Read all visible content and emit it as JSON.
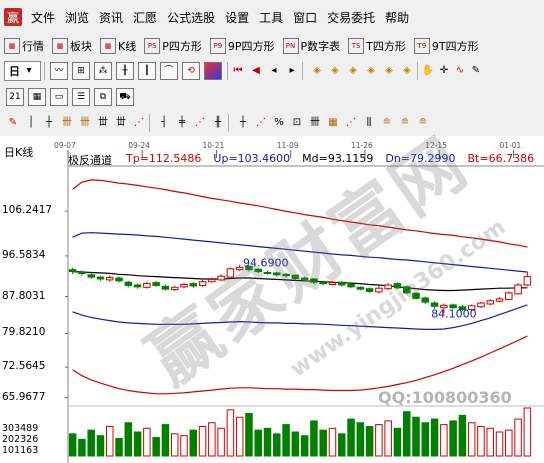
{
  "app": {
    "logo": "赢"
  },
  "menu": [
    "文件",
    "浏览",
    "资讯",
    "汇愿",
    "公式选股",
    "设置",
    "工具",
    "窗口",
    "交易委托",
    "帮助"
  ],
  "toolbar1": [
    {
      "label": "行情",
      "icon": "grid-icon"
    },
    {
      "label": "板块",
      "icon": "blocks-icon"
    },
    {
      "label": "K线",
      "icon": "candle-icon"
    },
    {
      "label": "P四方形",
      "icon": "p-icon",
      "badge": "PS"
    },
    {
      "label": "9P四方形",
      "icon": "p9-icon",
      "badge": "P9"
    },
    {
      "label": "P数字表",
      "icon": "pn-icon",
      "badge": "PN"
    },
    {
      "label": "T四方形",
      "icon": "t-icon",
      "badge": "TS"
    },
    {
      "label": "9T四方形",
      "icon": "t9-icon",
      "badge": "T9"
    }
  ],
  "toolbar2": {
    "period_select": "日"
  },
  "chart": {
    "period_label": "日K线",
    "indicator_name": "极反通道",
    "indicators": [
      {
        "label": "Tp=112.5486",
        "color": "#d40000"
      },
      {
        "label": "Up=103.4600",
        "color": "#1a1aa8"
      },
      {
        "label": "Md=93.1159",
        "color": "#000000"
      },
      {
        "label": "Dn=79.2990",
        "color": "#1a1aa8"
      },
      {
        "label": "Bt=66.7386",
        "color": "#d40000"
      }
    ],
    "y_ticks": [
      "106.2417",
      "96.5834",
      "87.8031",
      "79.8210",
      "72.5645",
      "65.9677"
    ],
    "volume_ticks": [
      "303489",
      "202326",
      "101163"
    ],
    "date_ticks": [
      "09-07",
      "09-24",
      "10-21",
      "11-09",
      "11-26",
      "12-15",
      "01-01"
    ],
    "annotations": [
      "94.6900",
      "84.1000"
    ],
    "watermark_text": "赢家财富网",
    "watermark_url": "www.yingjia360.com",
    "qq": "QQ:100800360"
  },
  "chart_data": {
    "type": "candlestick",
    "x": [
      "09-07",
      "09-24",
      "10-21",
      "11-09",
      "11-26",
      "12-15",
      "01-01"
    ],
    "ylim": [
      62,
      116
    ],
    "high_marker": 94.69,
    "low_marker": 84.1,
    "closes": [
      93.2,
      92.8,
      92.0,
      91.6,
      91.9,
      91.2,
      90.2,
      89.9,
      90.6,
      90.2,
      89.4,
      89.8,
      90.4,
      90.1,
      91.0,
      91.5,
      92.2,
      93.8,
      94.1,
      93.6,
      93.2,
      92.8,
      92.5,
      92.3,
      91.7,
      91.5,
      90.9,
      90.6,
      90.8,
      90.3,
      89.9,
      89.4,
      88.9,
      89.6,
      90.3,
      89.7,
      88.6,
      87.4,
      86.6,
      85.7,
      85.9,
      85.4,
      85.0,
      85.8,
      86.4,
      86.9,
      87.3,
      88.6,
      90.3,
      92.1
    ],
    "opens": [
      93.6,
      93.0,
      92.5,
      92.0,
      91.4,
      91.8,
      90.9,
      90.3,
      89.8,
      90.8,
      90.0,
      89.3,
      89.9,
      90.6,
      90.2,
      91.0,
      91.4,
      92.0,
      93.6,
      94.3,
      93.7,
      93.0,
      92.9,
      92.6,
      92.4,
      91.8,
      91.6,
      90.9,
      90.4,
      90.9,
      90.4,
      89.8,
      89.5,
      88.8,
      89.5,
      90.6,
      89.9,
      88.5,
      87.5,
      86.4,
      85.4,
      86.0,
      85.6,
      85.0,
      85.6,
      86.2,
      86.8,
      87.2,
      88.4,
      90.3
    ],
    "highs": [
      94.0,
      93.5,
      92.9,
      92.3,
      92.4,
      92.1,
      91.2,
      90.6,
      91.0,
      91.2,
      90.4,
      90.1,
      90.8,
      90.9,
      91.4,
      91.9,
      92.6,
      94.1,
      94.69,
      94.6,
      94.0,
      93.4,
      93.1,
      92.9,
      92.6,
      92.1,
      91.8,
      91.1,
      91.1,
      91.1,
      90.6,
      90.0,
      89.8,
      90.1,
      90.7,
      90.9,
      90.2,
      88.7,
      87.8,
      86.8,
      86.3,
      86.3,
      85.9,
      86.1,
      86.7,
      87.2,
      87.7,
      88.9,
      90.7,
      93.2
    ],
    "lows": [
      92.6,
      92.3,
      91.6,
      91.2,
      91.0,
      90.8,
      89.8,
      89.5,
      89.5,
      89.9,
      89.1,
      89.0,
      89.6,
      89.7,
      89.9,
      90.8,
      91.1,
      91.8,
      93.3,
      93.2,
      92.8,
      92.5,
      92.1,
      91.9,
      91.4,
      91.2,
      90.5,
      90.2,
      90.2,
      90.0,
      89.6,
      89.1,
      88.6,
      88.5,
      89.2,
      89.4,
      88.3,
      87.1,
      86.2,
      85.2,
      84.1,
      85.1,
      84.7,
      84.8,
      85.3,
      85.9,
      86.6,
      87.0,
      88.2,
      90.0
    ],
    "volumes": [
      120,
      90,
      140,
      110,
      160,
      95,
      180,
      130,
      150,
      100,
      170,
      120,
      110,
      140,
      160,
      180,
      150,
      250,
      210,
      230,
      140,
      150,
      120,
      170,
      130,
      110,
      190,
      140,
      150,
      120,
      200,
      180,
      160,
      170,
      190,
      150,
      240,
      210,
      180,
      200,
      170,
      190,
      220,
      180,
      160,
      150,
      130,
      140,
      200,
      260
    ],
    "upper_bands": {
      "Tp": [
        111,
        112.5,
        113,
        112.9,
        112.6,
        112.3,
        112.1,
        111.8,
        111.5,
        111.2,
        110.9,
        110.5,
        110.2,
        109.8,
        109.4,
        109.0,
        108.7,
        108.4,
        108.0,
        107.7,
        107.4,
        107.0,
        106.6,
        106.2,
        105.9,
        105.5,
        105.2,
        104.9,
        104.5,
        104.2,
        103.9,
        103.6,
        103.3,
        103.1,
        102.8,
        102.5,
        102.2,
        102.0,
        101.7,
        101.4,
        101.2,
        101.0,
        100.7,
        100.5,
        100.2,
        99.9,
        99.6,
        99.2,
        98.9,
        98.5
      ],
      "Up": [
        100.6,
        101.5,
        101.6,
        101.5,
        101.4,
        101.3,
        101.2,
        101.1,
        100.9,
        100.8,
        100.6,
        100.4,
        100.2,
        100.0,
        99.8,
        99.6,
        99.4,
        99.2,
        99.0,
        98.8,
        98.6,
        98.4,
        98.2,
        98.0,
        97.8,
        97.6,
        97.4,
        97.2,
        97.0,
        96.8,
        96.7,
        96.5,
        96.3,
        96.2,
        96.0,
        95.8,
        95.7,
        95.5,
        95.3,
        95.1,
        94.9,
        94.7,
        94.5,
        94.3,
        94.1,
        93.9,
        93.7,
        93.5,
        93.3,
        93.1
      ],
      "Md": [
        93.2,
        93.1,
        93.0,
        92.9,
        92.8,
        92.6,
        92.5,
        92.3,
        92.2,
        92.1,
        92.0,
        91.9,
        91.8,
        91.7,
        91.6,
        91.6,
        91.6,
        91.7,
        91.8,
        91.8,
        91.7,
        91.6,
        91.5,
        91.4,
        91.3,
        91.2,
        91.1,
        91.0,
        90.9,
        90.8,
        90.7,
        90.6,
        90.4,
        90.3,
        90.1,
        89.9,
        89.7,
        89.5,
        89.3,
        89.2,
        89.1,
        89.1,
        89.2,
        89.3,
        89.4,
        89.5,
        89.6,
        89.6,
        89.7,
        89.7
      ],
      "Dn": [
        84.5,
        83.8,
        83.3,
        82.9,
        82.6,
        82.3,
        82.1,
        82.0,
        81.9,
        81.8,
        81.8,
        81.8,
        81.8,
        81.9,
        82.0,
        82.1,
        82.2,
        82.3,
        82.4,
        82.3,
        82.2,
        82.1,
        82.1,
        82.0,
        82.0,
        81.9,
        81.9,
        81.8,
        81.7,
        81.6,
        81.5,
        81.4,
        81.3,
        81.2,
        81.1,
        81.0,
        80.9,
        80.8,
        80.7,
        80.7,
        80.8,
        81.1,
        81.5,
        82.0,
        82.6,
        83.2,
        83.9,
        84.6,
        85.3,
        86.0
      ],
      "Bt": [
        72.0,
        70.7,
        69.8,
        69.1,
        68.5,
        67.9,
        67.5,
        67.2,
        67.0,
        66.8,
        66.8,
        66.9,
        67.0,
        67.2,
        67.4,
        67.6,
        67.8,
        68.0,
        68.1,
        68.1,
        68.0,
        67.9,
        67.9,
        67.8,
        67.8,
        67.7,
        67.7,
        67.6,
        67.5,
        67.5,
        67.5,
        67.6,
        67.8,
        68.1,
        68.4,
        68.8,
        69.2,
        69.7,
        70.3,
        70.9,
        71.6,
        72.3,
        73.1,
        73.9,
        74.7,
        75.6,
        76.5,
        77.4,
        78.3,
        79.3
      ]
    }
  }
}
